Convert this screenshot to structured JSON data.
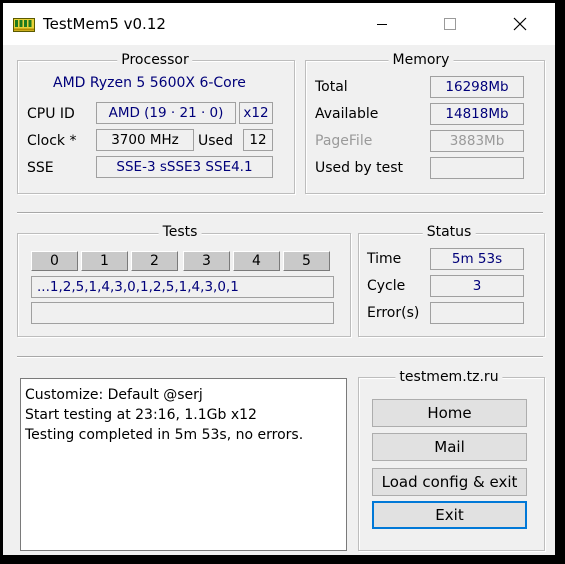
{
  "window": {
    "title": "TestMem5 v0.12"
  },
  "processor": {
    "title": "Processor",
    "cpu_name": "AMD Ryzen 5 5600X 6-Core",
    "cpu_id_label": "CPU ID",
    "cpu_id_value": "AMD (19 · 21 · 0)",
    "threads_value": "x12",
    "clock_label": "Clock *",
    "clock_value": "3700 MHz",
    "used_label": "Used",
    "used_value": "12",
    "sse_label": "SSE",
    "sse_value": "SSE-3 sSSE3 SSE4.1"
  },
  "memory": {
    "title": "Memory",
    "total_label": "Total",
    "total_value": "16298Mb",
    "available_label": "Available",
    "available_value": "14818Mb",
    "pagefile_label": "PageFile",
    "pagefile_value": "3883Mb",
    "used_by_test_label": "Used by test",
    "used_by_test_value": ""
  },
  "tests": {
    "title": "Tests",
    "columns": [
      "0",
      "1",
      "2",
      "3",
      "4",
      "5"
    ],
    "sequence": "...1,2,5,1,4,3,0,1,2,5,1,4,3,0,1",
    "progress": ""
  },
  "status": {
    "title": "Status",
    "time_label": "Time",
    "time_value": "5m 53s",
    "cycle_label": "Cycle",
    "cycle_value": "3",
    "errors_label": "Error(s)",
    "errors_value": ""
  },
  "log": {
    "lines": [
      "Customize: Default @serj",
      "Start testing at 23:16, 1.1Gb x12",
      "Testing completed in 5m 53s, no errors."
    ]
  },
  "links": {
    "title": "testmem.tz.ru",
    "home_label": "Home",
    "mail_label": "Mail",
    "load_config_label": "Load config & exit",
    "exit_label": "Exit"
  }
}
